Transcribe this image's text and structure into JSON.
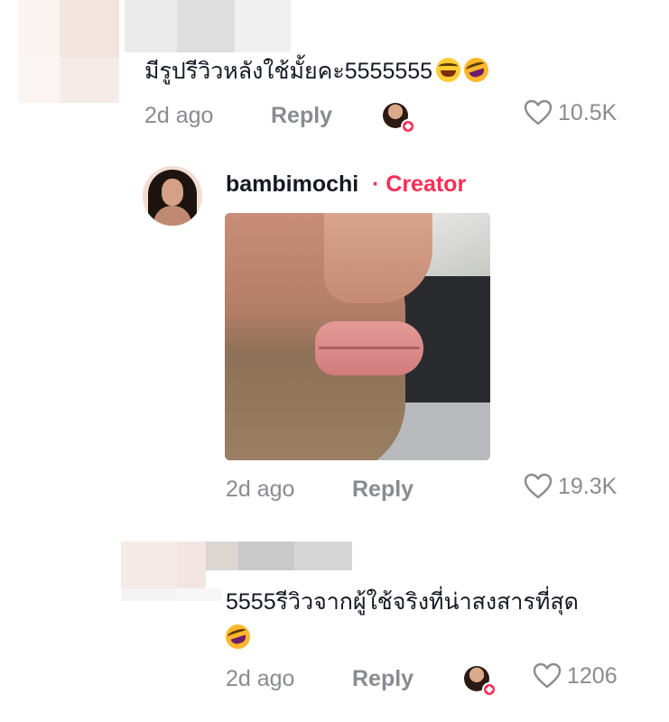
{
  "comments": [
    {
      "text": "มีรูปรีวิวหลังใช้มั้ยคะ5555555",
      "emojis": [
        "face-with-tears-of-joy",
        "rolling-on-the-floor-laughing"
      ],
      "time": "2d ago",
      "reply_label": "Reply",
      "likes": "10.5K",
      "liked_by_creator": true
    },
    {
      "username": "bambimochi",
      "badge": "· Creator",
      "has_photo": true,
      "time": "2d ago",
      "reply_label": "Reply",
      "likes": "19.3K"
    },
    {
      "text_line1": "5555รีวิวจากผู้ใช้จริงที่น่าสงสารที่สุด",
      "emojis": [
        "rolling-on-the-floor-laughing"
      ],
      "time": "2d ago",
      "reply_label": "Reply",
      "likes": "1206",
      "liked_by_creator": true
    }
  ],
  "colors": {
    "creator_accent": "#fe2c55",
    "meta_gray": "#8a8b91",
    "text": "#161823"
  }
}
